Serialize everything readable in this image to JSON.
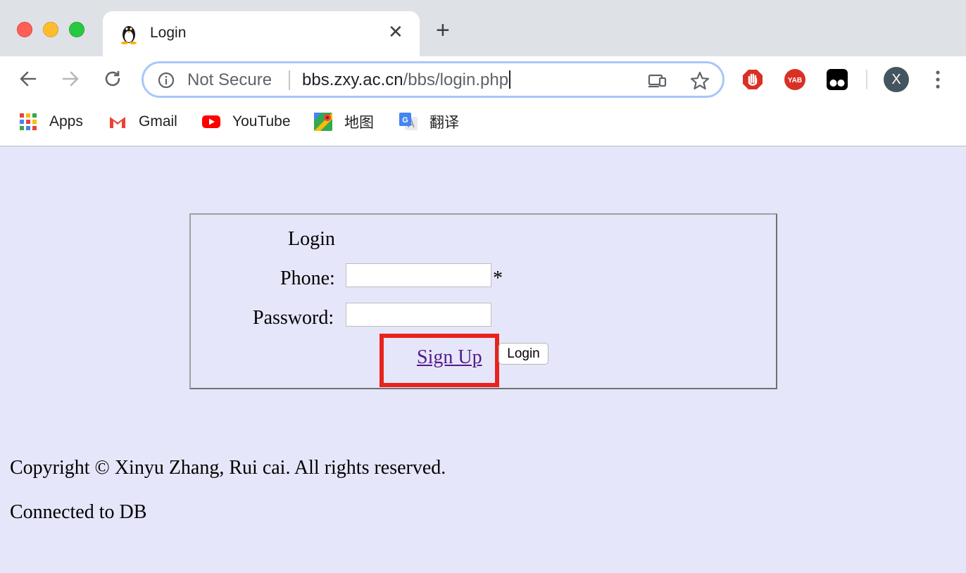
{
  "browser": {
    "tab": {
      "title": "Login",
      "close_glyph": "✕",
      "favicon": "penguin-icon"
    },
    "new_tab_glyph": "+",
    "address_bar": {
      "security_label": "Not Secure",
      "url_host": "bbs.zxy.ac.cn",
      "url_path": "/bbs/login.php"
    },
    "extensions": [
      "adblock-hand-icon",
      "yab-icon",
      "tampermonkey-icon"
    ],
    "profile_initial": "X",
    "bookmarks": [
      {
        "label": "Apps",
        "icon": "apps-grid-icon"
      },
      {
        "label": "Gmail",
        "icon": "gmail-icon"
      },
      {
        "label": "YouTube",
        "icon": "youtube-icon"
      },
      {
        "label": "地图",
        "icon": "maps-icon"
      },
      {
        "label": "翻译",
        "icon": "translate-icon"
      }
    ]
  },
  "page": {
    "form": {
      "title": "Login",
      "phone_label": "Phone:",
      "phone_value": "",
      "required_mark": "*",
      "password_label": "Password:",
      "password_value": "",
      "signup_link": "Sign Up",
      "login_button": "Login"
    },
    "footer": {
      "copyright": "Copyright © Xinyu Zhang, Rui cai. All rights reserved.",
      "db_status": "Connected to DB"
    }
  },
  "colors": {
    "page_background": "#e6e6fa",
    "highlight_box": "#e8231c",
    "visited_link": "#551a8b"
  }
}
